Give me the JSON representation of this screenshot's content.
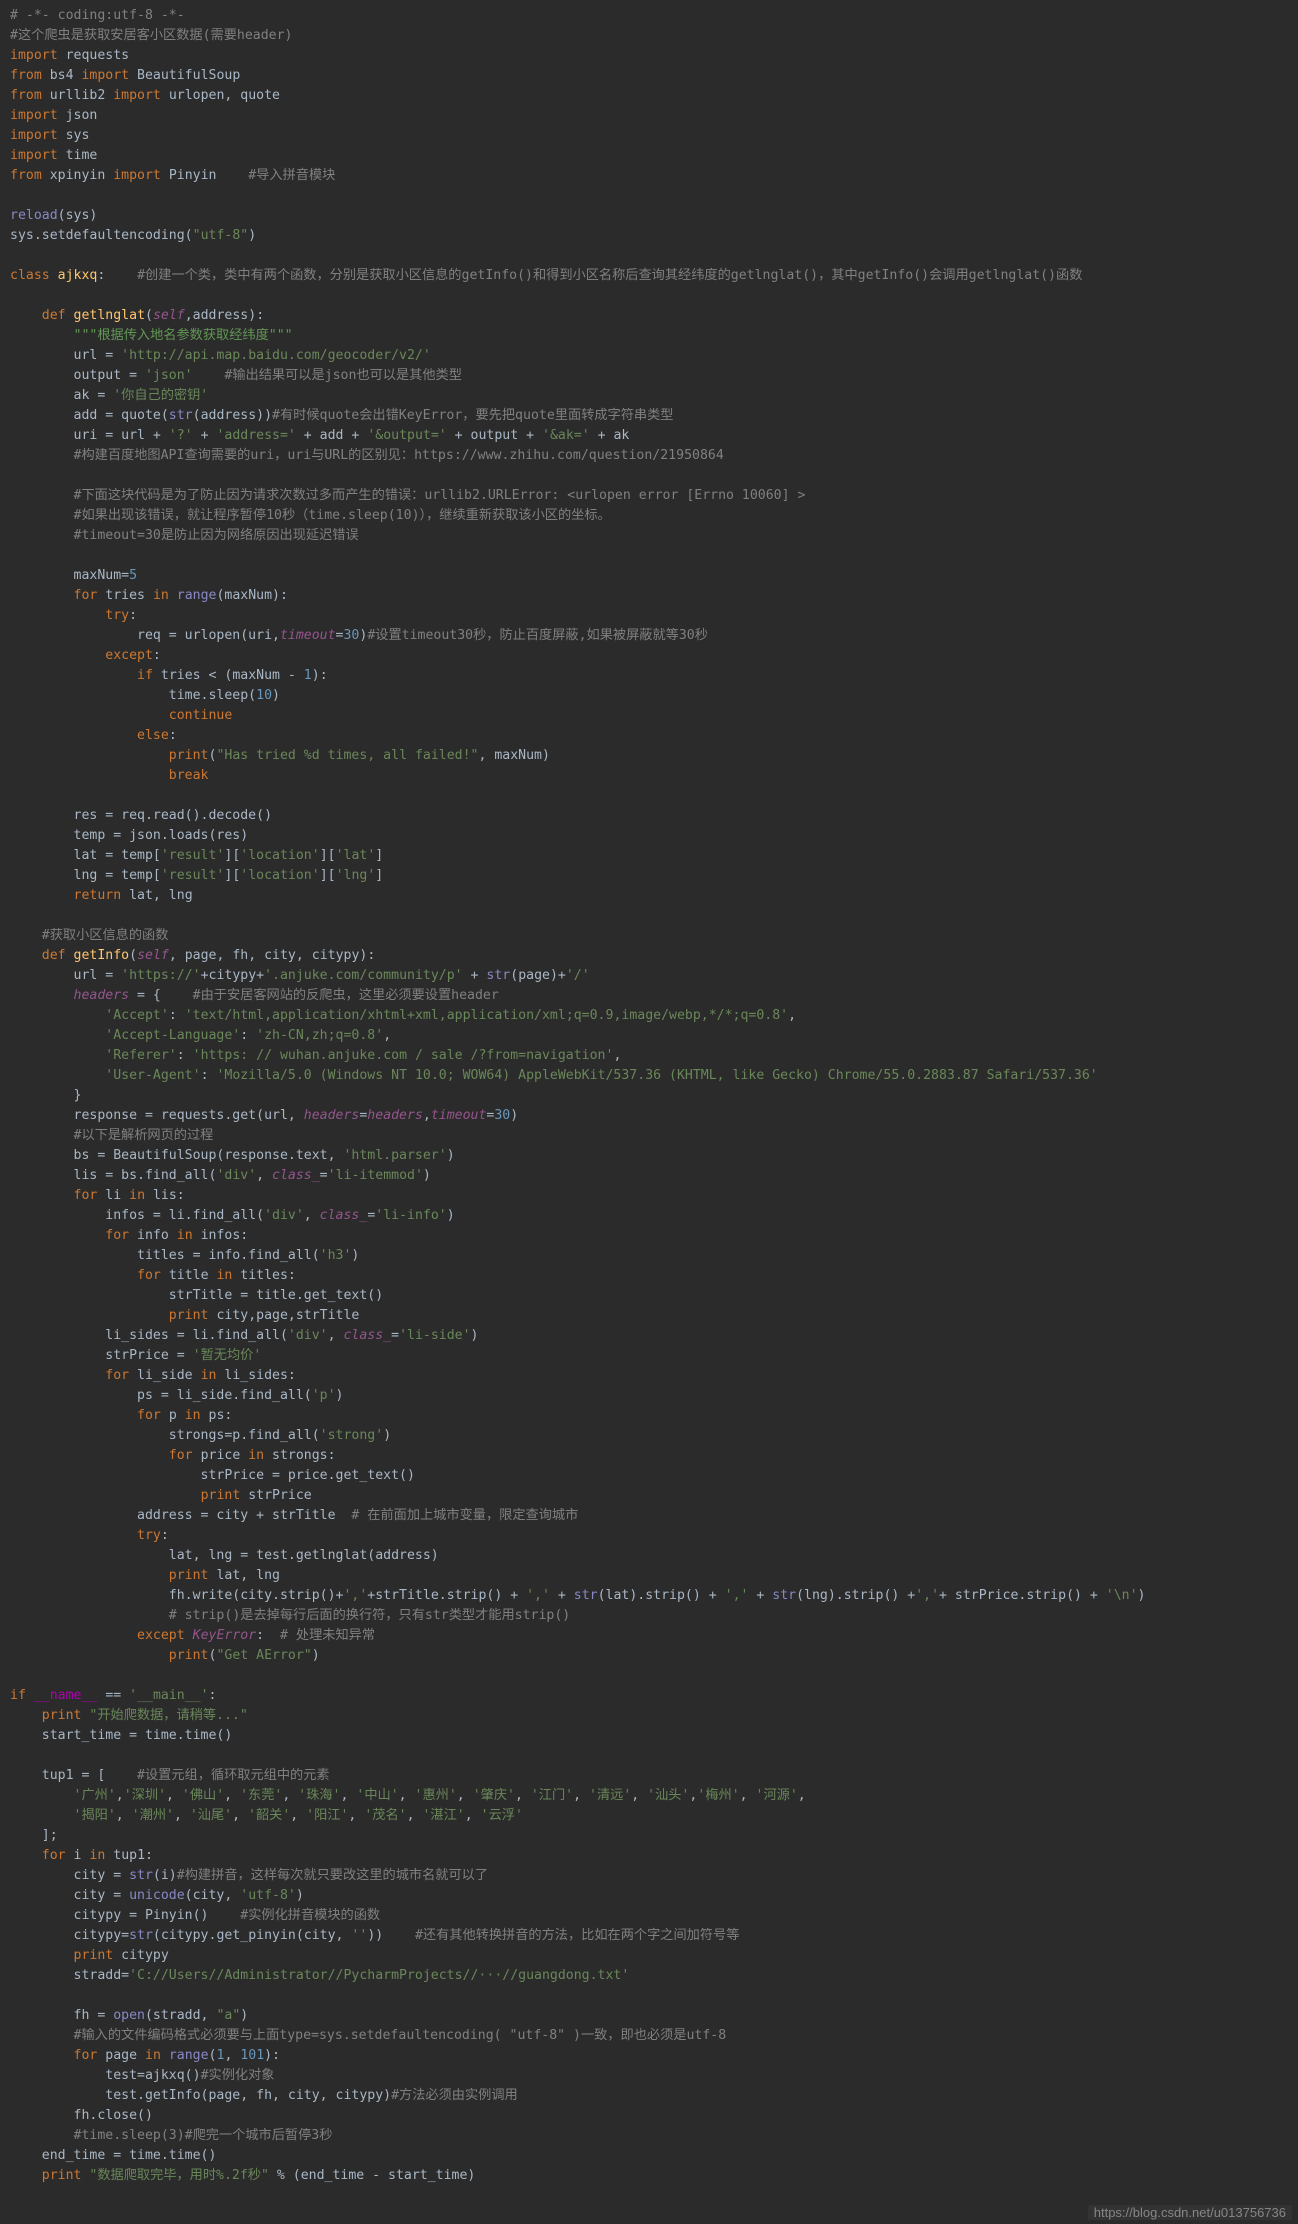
{
  "editor": {
    "background": "#2b2b2b",
    "watermark": "https://blog.csdn.net/u013756736"
  },
  "code_lines": [
    "# -*- coding:utf-8 -*-",
    "#这个爬虫是获取安居客小区数据(需要header)",
    "import requests",
    "from bs4 import BeautifulSoup",
    "from urllib2 import urlopen, quote",
    "import json",
    "import sys",
    "import time",
    "from xpinyin import Pinyin    #导入拼音模块",
    "",
    "reload(sys)",
    "sys.setdefaultencoding(\"utf-8\")",
    "",
    "class ajkxq:    #创建一个类，类中有两个函数，分别是获取小区信息的getInfo()和得到小区名称后查询其经纬度的getlnglat()，其中getInfo()会调用getlnglat()函数",
    "",
    "    def getlnglat(self,address):",
    "        \"\"\"根据传入地名参数获取经纬度\"\"\"",
    "        url = 'http://api.map.baidu.com/geocoder/v2/'",
    "        output = 'json'    #输出结果可以是json也可以是其他类型",
    "        ak = '你自己的密钥'",
    "        add = quote(str(address))#有时候quote会出错KeyError，要先把quote里面转成字符串类型",
    "        uri = url + '?' + 'address=' + add + '&output=' + output + '&ak=' + ak",
    "        #构建百度地图API查询需要的uri，uri与URL的区别见：https://www.zhihu.com/question/21950864",
    "",
    "        #下面这块代码是为了防止因为请求次数过多而产生的错误：urllib2.URLError: <urlopen error [Errno 10060] >",
    "        #如果出现该错误，就让程序暂停10秒（time.sleep(10)），继续重新获取该小区的坐标。",
    "        #timeout=30是防止因为网络原因出现延迟错误",
    "",
    "        maxNum=5",
    "        for tries in range(maxNum):",
    "            try:",
    "                req = urlopen(uri,timeout=30)#设置timeout30秒，防止百度屏蔽,如果被屏蔽就等30秒",
    "            except:",
    "                if tries < (maxNum - 1):",
    "                    time.sleep(10)",
    "                    continue",
    "                else:",
    "                    print(\"Has tried %d times, all failed!\", maxNum)",
    "                    break",
    "",
    "        res = req.read().decode()",
    "        temp = json.loads(res)",
    "        lat = temp['result']['location']['lat']",
    "        lng = temp['result']['location']['lng']",
    "        return lat, lng",
    "",
    "    #获取小区信息的函数",
    "    def getInfo(self, page, fh, city, citypy):",
    "        url = 'https://'+citypy+'.anjuke.com/community/p' + str(page)+'/'",
    "        headers = {    #由于安居客网站的反爬虫，这里必须要设置header",
    "            'Accept': 'text/html,application/xhtml+xml,application/xml;q=0.9,image/webp,*/*;q=0.8',",
    "            'Accept-Language': 'zh-CN,zh;q=0.8',",
    "            'Referer': 'https: // wuhan.anjuke.com / sale /?from=navigation',",
    "            'User-Agent': 'Mozilla/5.0 (Windows NT 10.0; WOW64) AppleWebKit/537.36 (KHTML, like Gecko) Chrome/55.0.2883.87 Safari/537.36'",
    "        }",
    "        response = requests.get(url, headers=headers,timeout=30)",
    "        #以下是解析网页的过程",
    "        bs = BeautifulSoup(response.text, 'html.parser')",
    "        lis = bs.find_all('div', class_='li-itemmod')",
    "        for li in lis:",
    "            infos = li.find_all('div', class_='li-info')",
    "            for info in infos:",
    "                titles = info.find_all('h3')",
    "                for title in titles:",
    "                    strTitle = title.get_text()",
    "                    print city,page,strTitle",
    "            li_sides = li.find_all('div', class_='li-side')",
    "            strPrice = '暂无均价'",
    "            for li_side in li_sides:",
    "                ps = li_side.find_all('p')",
    "                for p in ps:",
    "                    strongs=p.find_all('strong')",
    "                    for price in strongs:",
    "                        strPrice = price.get_text()",
    "                        print strPrice",
    "                address = city + strTitle  # 在前面加上城市变量，限定查询城市",
    "                try:",
    "                    lat, lng = test.getlnglat(address)",
    "                    print lat, lng",
    "                    fh.write(city.strip()+','+strTitle.strip() + ',' + str(lat).strip() + ',' + str(lng).strip() +','+ strPrice.strip() + '\\n')",
    "                    # strip()是去掉每行后面的换行符，只有str类型才能用strip()",
    "                except KeyError:  # 处理未知异常",
    "                    print(\"Get AError\")",
    "",
    "if __name__ == '__main__':",
    "    print \"开始爬数据，请稍等...\"",
    "    start_time = time.time()",
    "",
    "    tup1 = [    #设置元组，循环取元组中的元素",
    "        '广州','深圳', '佛山', '东莞', '珠海', '中山', '惠州', '肇庆', '江门', '清远', '汕头','梅州', '河源',",
    "        '揭阳', '潮州', '汕尾', '韶关', '阳江', '茂名', '湛江', '云浮'",
    "    ];",
    "    for i in tup1:",
    "        city = str(i)#构建拼音，这样每次就只要改这里的城市名就可以了",
    "        city = unicode(city, 'utf-8')",
    "        citypy = Pinyin()    #实例化拼音模块的函数",
    "        citypy=str(citypy.get_pinyin(city, ''))    #还有其他转换拼音的方法，比如在两个字之间加符号等",
    "        print citypy",
    "        stradd='C://Users//Administrator//PycharmProjects//···//guangdong.txt'",
    "",
    "        fh = open(stradd, \"a\")",
    "        #输入的文件编码格式必须要与上面type=sys.setdefaultencoding( \"utf-8\" )一致，即也必须是utf-8",
    "        for page in range(1, 101):",
    "            test=ajkxq()#实例化对象",
    "            test.getInfo(page, fh, city, citypy)#方法必须由实例调用",
    "        fh.close()",
    "        #time.sleep(3)#爬完一个城市后暂停3秒",
    "    end_time = time.time()",
    "    print \"数据爬取完毕，用时%.2f秒\" % (end_time - start_time)"
  ]
}
